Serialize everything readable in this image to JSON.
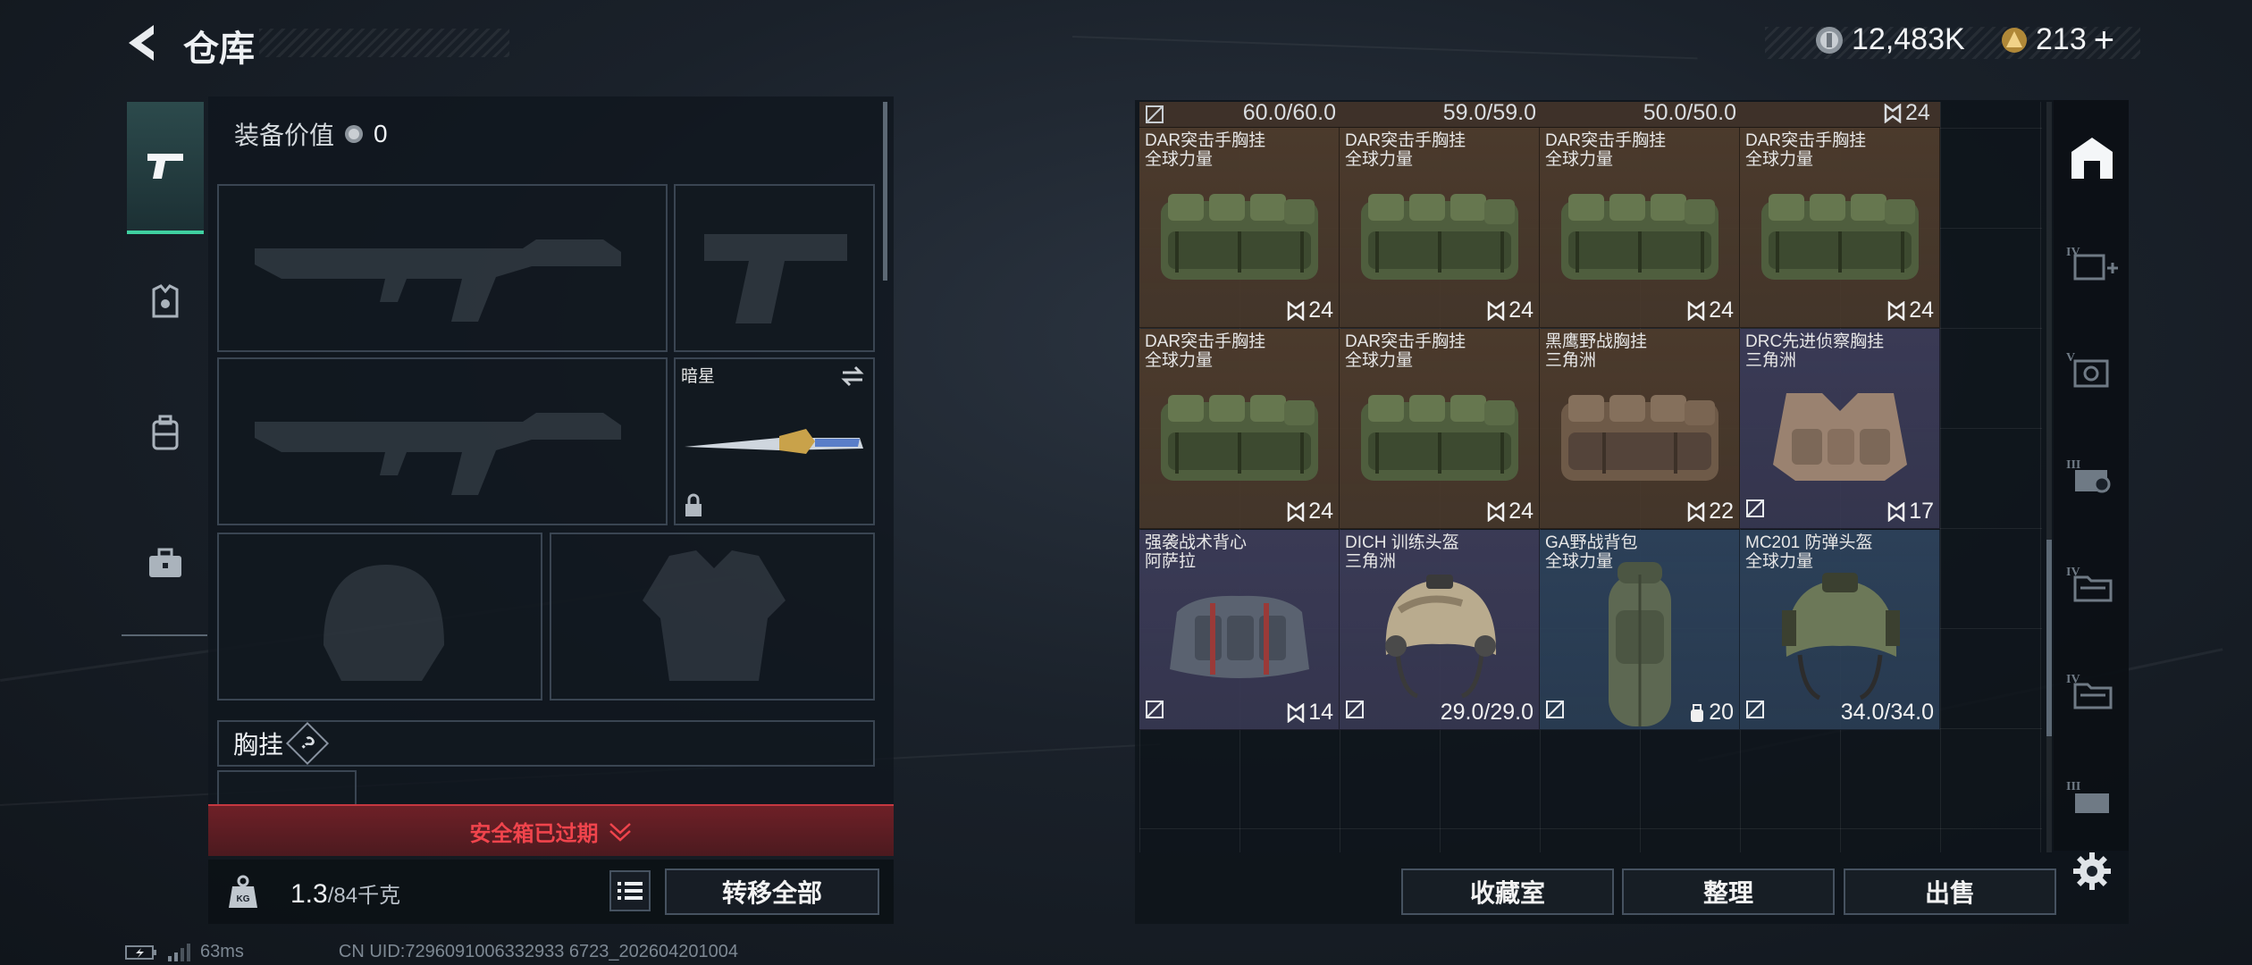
{
  "header": {
    "title": "仓库"
  },
  "currency": {
    "coins": "12,483K",
    "tokens": "213",
    "plus": "+"
  },
  "equipment": {
    "value_label": "装备价值",
    "value": "0",
    "melee_name": "暗星",
    "chest_rig_label": "胸挂",
    "help_symbol": "?"
  },
  "left_tabs": [
    {
      "icon": "pistol-icon",
      "active": true
    },
    {
      "icon": "armor-icon",
      "active": false
    },
    {
      "icon": "backpack-icon",
      "active": false
    },
    {
      "icon": "toolbox-icon",
      "active": false
    }
  ],
  "safebox": {
    "expired_text": "安全箱已过期"
  },
  "capacity": {
    "current": "1.3",
    "max": "/84千克",
    "weight_icon_text": "KG"
  },
  "buttons": {
    "transfer_all": "转移全部",
    "collection": "收藏室",
    "organize": "整理",
    "sell": "出售"
  },
  "grid_top_row": [
    "60.0/60.0",
    "59.0/59.0",
    "50.0/50.0",
    "24"
  ],
  "items": [
    {
      "name": "DAR突击手胸挂",
      "source": "全球力量",
      "value": "24",
      "bg": "#4b3a2c",
      "kind": "rig-green",
      "mod": false
    },
    {
      "name": "DAR突击手胸挂",
      "source": "全球力量",
      "value": "24",
      "bg": "#4b3a2c",
      "kind": "rig-green",
      "mod": false
    },
    {
      "name": "DAR突击手胸挂",
      "source": "全球力量",
      "value": "24",
      "bg": "#4b3a2c",
      "kind": "rig-green",
      "mod": false
    },
    {
      "name": "DAR突击手胸挂",
      "source": "全球力量",
      "value": "24",
      "bg": "#4b3a2c",
      "kind": "rig-green",
      "mod": false
    },
    {
      "name": "DAR突击手胸挂",
      "source": "全球力量",
      "value": "24",
      "bg": "#4b3a2c",
      "kind": "rig-green",
      "mod": false
    },
    {
      "name": "DAR突击手胸挂",
      "source": "全球力量",
      "value": "24",
      "bg": "#4b3a2c",
      "kind": "rig-green",
      "mod": false
    },
    {
      "name": "黑鹰野战胸挂",
      "source": "三角洲",
      "value": "22",
      "bg": "#4b3a2c",
      "kind": "rig-brown",
      "mod": false
    },
    {
      "name": "DRC先进侦察胸挂",
      "source": "三角洲",
      "value": "17",
      "bg": "#3a3a55",
      "kind": "rig-tan",
      "mod": true
    },
    {
      "name": "强袭战术背心",
      "source": "阿萨拉",
      "value": "14",
      "bg": "#3a3a55",
      "kind": "vest",
      "mod": true
    },
    {
      "name": "DICH 训练头盔",
      "source": "三角洲",
      "value": "29.0/29.0",
      "bg": "#3a3a55",
      "kind": "helmet-tan",
      "mod": true
    },
    {
      "name": "GA野战背包",
      "source": "全球力量",
      "value": "20",
      "bg": "#2c4058",
      "kind": "backpack",
      "mod": true
    },
    {
      "name": "MC201 防弹头盔",
      "source": "全球力量",
      "value": "34.0/34.0",
      "bg": "#2c4058",
      "kind": "helmet-green",
      "mod": true
    }
  ],
  "status": {
    "ping": "63ms",
    "uid": "CN UID:7296091006332933 6723_202604201004"
  },
  "colors": {
    "accent_green": "#3fd0a0",
    "danger_red": "#e0393e",
    "gold": "#c9a24a"
  }
}
